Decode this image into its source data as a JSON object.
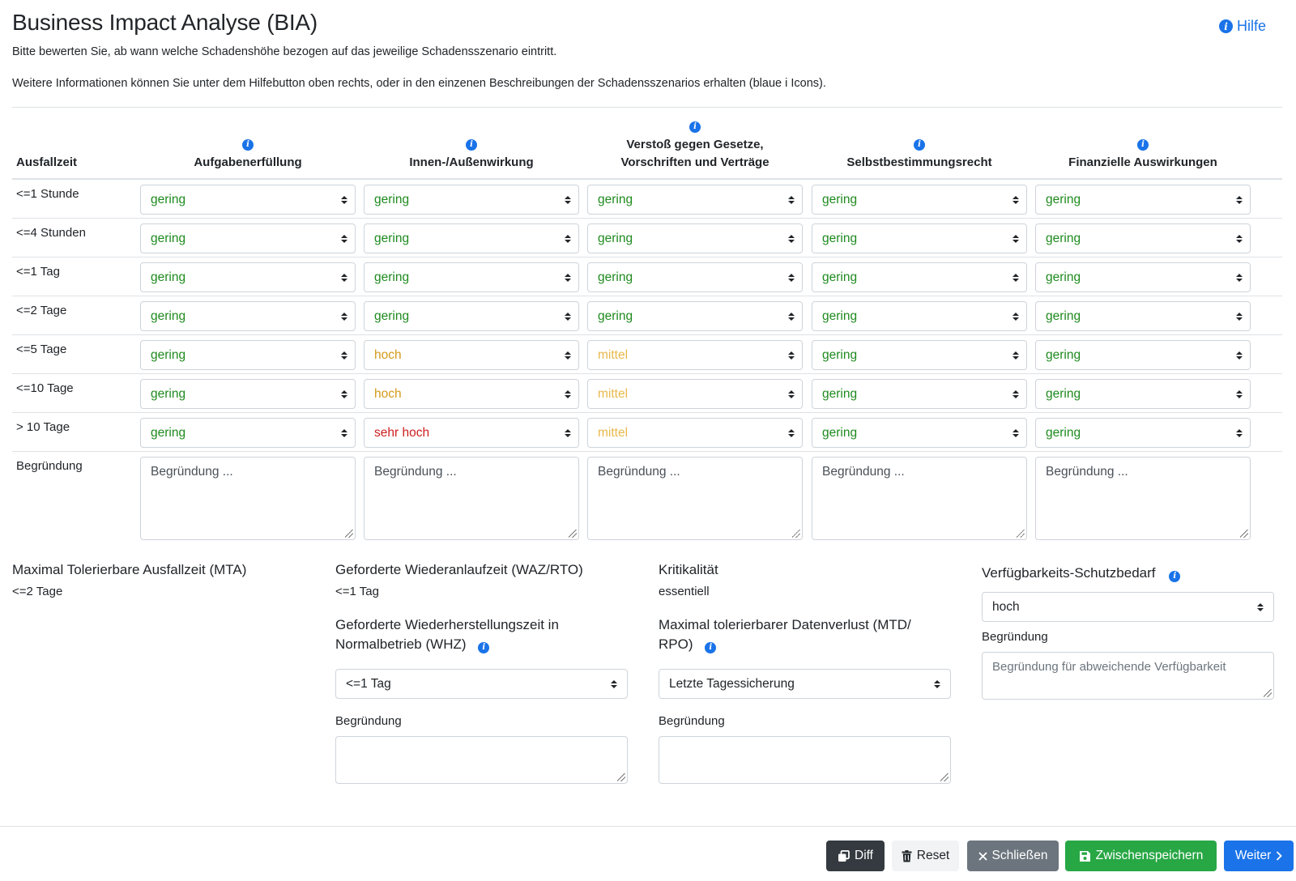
{
  "header": {
    "title": "Business Impact Analyse (BIA)",
    "help_label": "Hilfe",
    "intro_line1": "Bitte bewerten Sie, ab wann welche Schadenshöhe bezogen auf das jeweilige Schadensszenario eintritt.",
    "intro_line2": "Weitere Informationen können Sie unter dem Hilfebutton oben rechts, oder in den einzenen Beschreibungen der Schadensszenarios erhalten (blaue i Icons)."
  },
  "matrix": {
    "first_col_header": "Ausfallzeit",
    "columns": [
      "Aufgabenerfüllung",
      "Innen-/Außenwirkung",
      "Verstoß gegen Gesetze,",
      "Selbstbestimmungsrecht",
      "Finanzielle Auswirkungen"
    ],
    "column3_line2": "Vorschriften und Verträge",
    "rows": [
      {
        "label": "<=1 Stunde",
        "values": [
          "gering",
          "gering",
          "gering",
          "gering",
          "gering"
        ]
      },
      {
        "label": "<=4 Stunden",
        "values": [
          "gering",
          "gering",
          "gering",
          "gering",
          "gering"
        ]
      },
      {
        "label": "<=1 Tag",
        "values": [
          "gering",
          "gering",
          "gering",
          "gering",
          "gering"
        ]
      },
      {
        "label": "<=2 Tage",
        "values": [
          "gering",
          "gering",
          "gering",
          "gering",
          "gering"
        ]
      },
      {
        "label": "<=5 Tage",
        "values": [
          "gering",
          "hoch",
          "mittel",
          "gering",
          "gering"
        ]
      },
      {
        "label": "<=10 Tage",
        "values": [
          "gering",
          "hoch",
          "mittel",
          "gering",
          "gering"
        ]
      },
      {
        "label": "> 10 Tage",
        "values": [
          "gering",
          "sehr hoch",
          "mittel",
          "gering",
          "gering"
        ]
      }
    ],
    "reason_label": "Begründung",
    "reason_placeholder": "Begründung ...",
    "level_colors": {
      "gering": "#1e8a1e",
      "mittel": "#e8b84a",
      "hoch": "#d49a1a",
      "sehr hoch": "#cc1f1f"
    }
  },
  "summary": {
    "mta": {
      "label": "Maximal Tolerierbare Ausfallzeit (MTA)",
      "value": "<=2 Tage"
    },
    "waz": {
      "label": "Geforderte Wiederanlaufzeit (WAZ/RTO)",
      "value": "<=1 Tag"
    },
    "kritikalitaet": {
      "label": "Kritikalität",
      "value": "essentiell"
    },
    "whz": {
      "label_line1": "Geforderte Wiederherstellungszeit in",
      "label_line2": "Normalbetrieb (WHZ)",
      "selected": "<=1 Tag",
      "reason_label": "Begründung"
    },
    "mtd": {
      "label_line1": "Maximal tolerierbarer Datenverlust (MTD/",
      "label_line2": "RPO)",
      "selected": "Letzte Tagessicherung",
      "reason_label": "Begründung"
    },
    "verfuegbarkeit": {
      "label": "Verfügbarkeits-Schutzbedarf",
      "selected": "hoch",
      "reason_label": "Begründung",
      "reason_placeholder": "Begründung für abweichende Verfügbarkeit"
    }
  },
  "footer": {
    "diff": "Diff",
    "reset": "Reset",
    "close": "Schließen",
    "save": "Zwischenspeichern",
    "next": "Weiter"
  },
  "icons": {
    "info": "info-icon",
    "help": "info-icon",
    "diff": "copy-icon",
    "reset": "trash-icon",
    "close": "close-icon",
    "save": "floppy-disk-icon",
    "next": "chevron-right-icon"
  }
}
